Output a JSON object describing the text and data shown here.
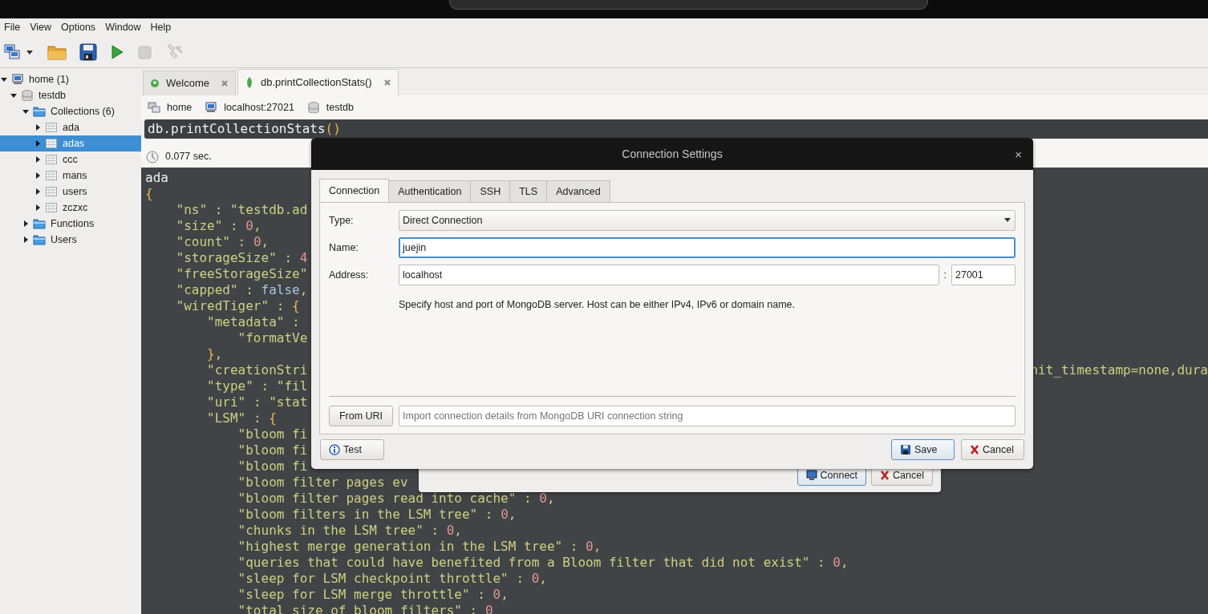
{
  "menu": [
    "File",
    "View",
    "Options",
    "Window",
    "Help"
  ],
  "toolbar": [
    {
      "kind": "connect",
      "disabled": false
    },
    {
      "kind": "open",
      "disabled": false
    },
    {
      "kind": "save",
      "disabled": false
    },
    {
      "kind": "run",
      "disabled": false
    },
    {
      "kind": "stop",
      "disabled": true
    },
    {
      "kind": "tool",
      "disabled": true
    }
  ],
  "tree": [
    {
      "label": "home (1)",
      "kind": "server",
      "expanded": true,
      "selected": false,
      "children": [
        {
          "label": "testdb",
          "kind": "database",
          "expanded": true,
          "selected": false,
          "children": [
            {
              "label": "Collections (6)",
              "kind": "folder",
              "expanded": true,
              "selected": false,
              "children": [
                {
                  "label": "ada",
                  "kind": "collection",
                  "expanded": false,
                  "selected": false
                },
                {
                  "label": "adas",
                  "kind": "collection",
                  "expanded": false,
                  "selected": true
                },
                {
                  "label": "ccc",
                  "kind": "collection",
                  "expanded": false,
                  "selected": false
                },
                {
                  "label": "mans",
                  "kind": "collection",
                  "expanded": false,
                  "selected": false
                },
                {
                  "label": "users",
                  "kind": "collection",
                  "expanded": false,
                  "selected": false
                },
                {
                  "label": "zczxc",
                  "kind": "collection",
                  "expanded": false,
                  "selected": false
                }
              ]
            },
            {
              "label": "Functions",
              "kind": "folder",
              "expanded": false,
              "selected": false
            },
            {
              "label": "Users",
              "kind": "folder",
              "expanded": false,
              "selected": false
            }
          ]
        }
      ]
    }
  ],
  "tabs": [
    {
      "label": "Welcome",
      "selected": false
    },
    {
      "label": "db.printCollectionStats()",
      "selected": true
    }
  ],
  "breadcrumb": [
    {
      "kind": "home",
      "label": "home"
    },
    {
      "kind": "server",
      "label": "localhost:27021"
    },
    {
      "kind": "database",
      "label": "testdb"
    }
  ],
  "query": "db.printCollectionStats()",
  "elapsed": "0.077 sec.",
  "output": [
    {
      "text": "ada"
    },
    {
      "text": "{"
    },
    {
      "text": "    \"ns\" : \"testdb.ad"
    },
    {
      "text": "    \"size\" : 0,"
    },
    {
      "text": "    \"count\" : 0,"
    },
    {
      "text": "    \"storageSize\" : 4"
    },
    {
      "text": "    \"freeStorageSize\""
    },
    {
      "text": "    \"capped\" : false,"
    },
    {
      "text": "    \"wiredTiger\" : {"
    },
    {
      "text": "        \"metadata\" :"
    },
    {
      "text": "            \"formatVe"
    },
    {
      "text": "        },"
    },
    {
      "text": "        \"creationStri",
      "tail": "nit_timestamp=none,dura"
    },
    {
      "text": "        \"type\" : \"fil"
    },
    {
      "text": "        \"uri\" : \"stat"
    },
    {
      "text": "        \"LSM\" : {"
    },
    {
      "text": "            \"bloom fi"
    },
    {
      "text": "            \"bloom fi"
    },
    {
      "text": "            \"bloom fi"
    },
    {
      "text": "            \"bloom filter pages ev"
    },
    {
      "text": "            \"bloom filter pages read into cache\" : 0,"
    },
    {
      "text": "            \"bloom filters in the LSM tree\" : 0,"
    },
    {
      "text": "            \"chunks in the LSM tree\" : 0,"
    },
    {
      "text": "            \"highest merge generation in the LSM tree\" : 0,"
    },
    {
      "text": "            \"queries that could have benefited from a Bloom filter that did not exist\" : 0,"
    },
    {
      "text": "            \"sleep for LSM checkpoint throttle\" : 0,"
    },
    {
      "text": "            \"sleep for LSM merge throttle\" : 0,"
    },
    {
      "text": "            \"total size of bloom filters\" : 0"
    }
  ],
  "connections_dialog": {
    "buttons": [
      {
        "kind": "connect",
        "label": "Connect",
        "default": true
      },
      {
        "kind": "cancel",
        "label": "Cancel",
        "default": false
      }
    ]
  },
  "connection_settings": {
    "title": "Connection Settings",
    "close": "×",
    "tabs": [
      {
        "label": "Connection",
        "selected": true
      },
      {
        "label": "Authentication",
        "selected": false
      },
      {
        "label": "SSH",
        "selected": false
      },
      {
        "label": "TLS",
        "selected": false
      },
      {
        "label": "Advanced",
        "selected": false
      }
    ],
    "type": {
      "label": "Type:",
      "value": "Direct Connection"
    },
    "name": {
      "label": "Name:",
      "value": "juejin",
      "focused": true
    },
    "address": {
      "label": "Address:",
      "host": "localhost",
      "separator": ":",
      "port": "27001"
    },
    "hint": "Specify host and port of MongoDB server. Host can be either IPv4, IPv6 or domain name.",
    "from_uri": {
      "button": "From URI",
      "placeholder": "Import connection details from MongoDB URI connection string"
    },
    "buttons": [
      {
        "kind": "test",
        "label": "Test",
        "default": false
      },
      {
        "kind": "save",
        "label": "Save",
        "default": true
      },
      {
        "kind": "cancel",
        "label": "Cancel",
        "default": false
      }
    ]
  }
}
